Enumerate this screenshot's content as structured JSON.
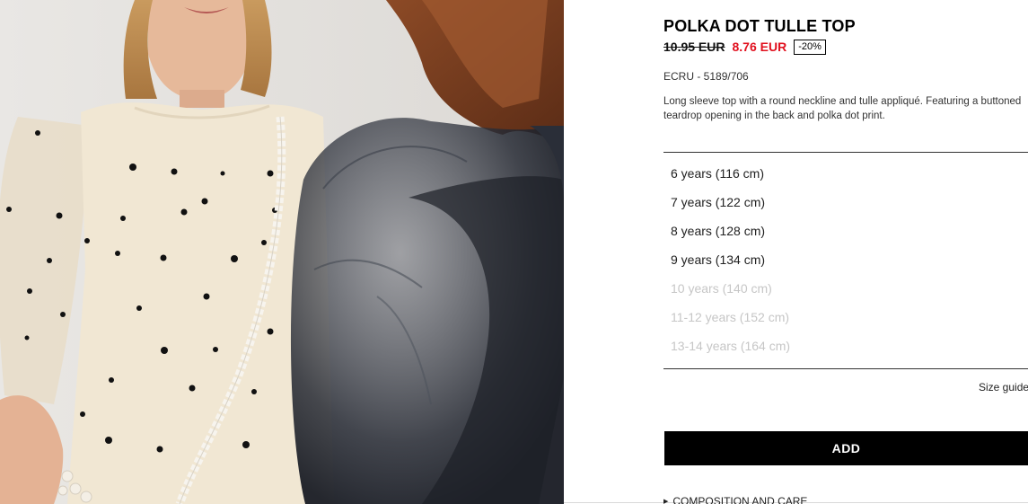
{
  "product": {
    "title": "POLKA DOT TULLE TOP",
    "old_price": "10.95 EUR",
    "new_price": "8.76 EUR",
    "discount": "-20%",
    "color_ref": "ECRU - 5189/706",
    "description": "Long sleeve top with a round neckline and tulle appliqué. Featuring a buttoned teardrop opening in the back and polka dot print."
  },
  "sizes": [
    {
      "label": "6 years (116 cm)",
      "available": true
    },
    {
      "label": "7 years (122 cm)",
      "available": true
    },
    {
      "label": "8 years (128 cm)",
      "available": true
    },
    {
      "label": "9 years (134 cm)",
      "available": true
    },
    {
      "label": "10 years (140 cm)",
      "available": false
    },
    {
      "label": "11-12 years (152 cm)",
      "available": false
    },
    {
      "label": "13-14 years (164 cm)",
      "available": false
    }
  ],
  "actions": {
    "size_guide_label": "Size guide",
    "add_label": "ADD",
    "composition_label": "COMPOSITION AND CARE"
  },
  "colors": {
    "sale_red": "#e1101e",
    "unavailable_grey": "#c6c6c6",
    "button_bg": "#000000"
  },
  "icons": {
    "composition_toggle": "triangle-right-icon"
  }
}
